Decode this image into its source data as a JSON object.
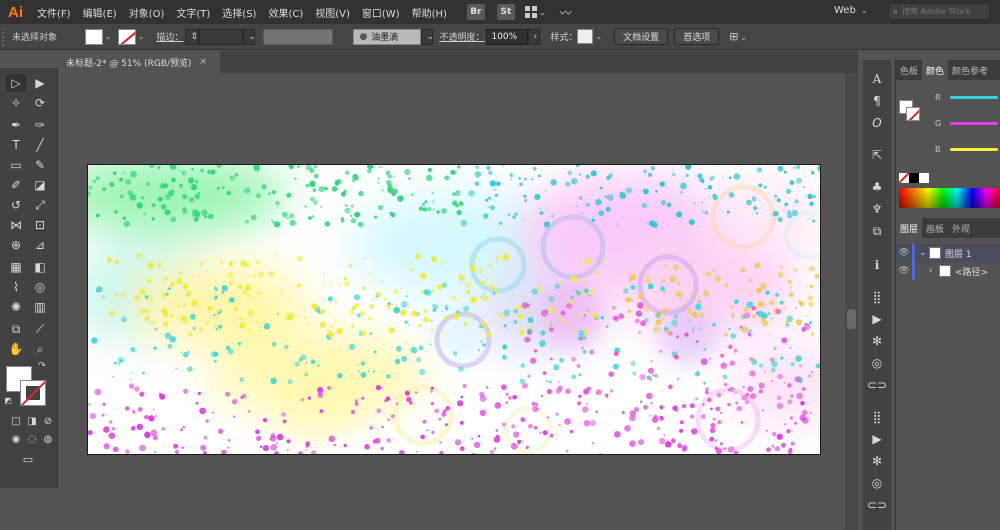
{
  "app": {
    "logo": "Ai"
  },
  "menu": {
    "items": [
      "文件(F)",
      "编辑(E)",
      "对象(O)",
      "文字(T)",
      "选择(S)",
      "效果(C)",
      "视图(V)",
      "窗口(W)",
      "帮助(H)"
    ],
    "bridge_label": "Br",
    "stock_label": "St",
    "workspace": "Web",
    "search_placeholder": "搜索 Adobe Stock"
  },
  "control": {
    "no_selection": "未选择对象",
    "stroke_label": "描边：",
    "brush_label": "油墨滴",
    "opacity_label": "不透明度：",
    "opacity_value": "100%",
    "style_label": "样式：",
    "doc_setup": "文档设置",
    "preferences": "首选项"
  },
  "document": {
    "tab_title": "未标题-2* @ 51% (RGB/预览)",
    "close_symbol": "×"
  },
  "panels": {
    "color_tabs": [
      "色板",
      "颜色",
      "颜色参考"
    ],
    "color_active_index": 1,
    "slider_labels": [
      "R",
      "G",
      "B"
    ],
    "slider_colors": [
      "#39d4e0",
      "#e33ee6",
      "#f6f230"
    ],
    "layers_tabs": [
      "图层",
      "画板",
      "外观"
    ],
    "layers": [
      {
        "name": "图层 1",
        "expanded": true
      },
      {
        "name": "<路径>",
        "expanded": false
      }
    ]
  }
}
